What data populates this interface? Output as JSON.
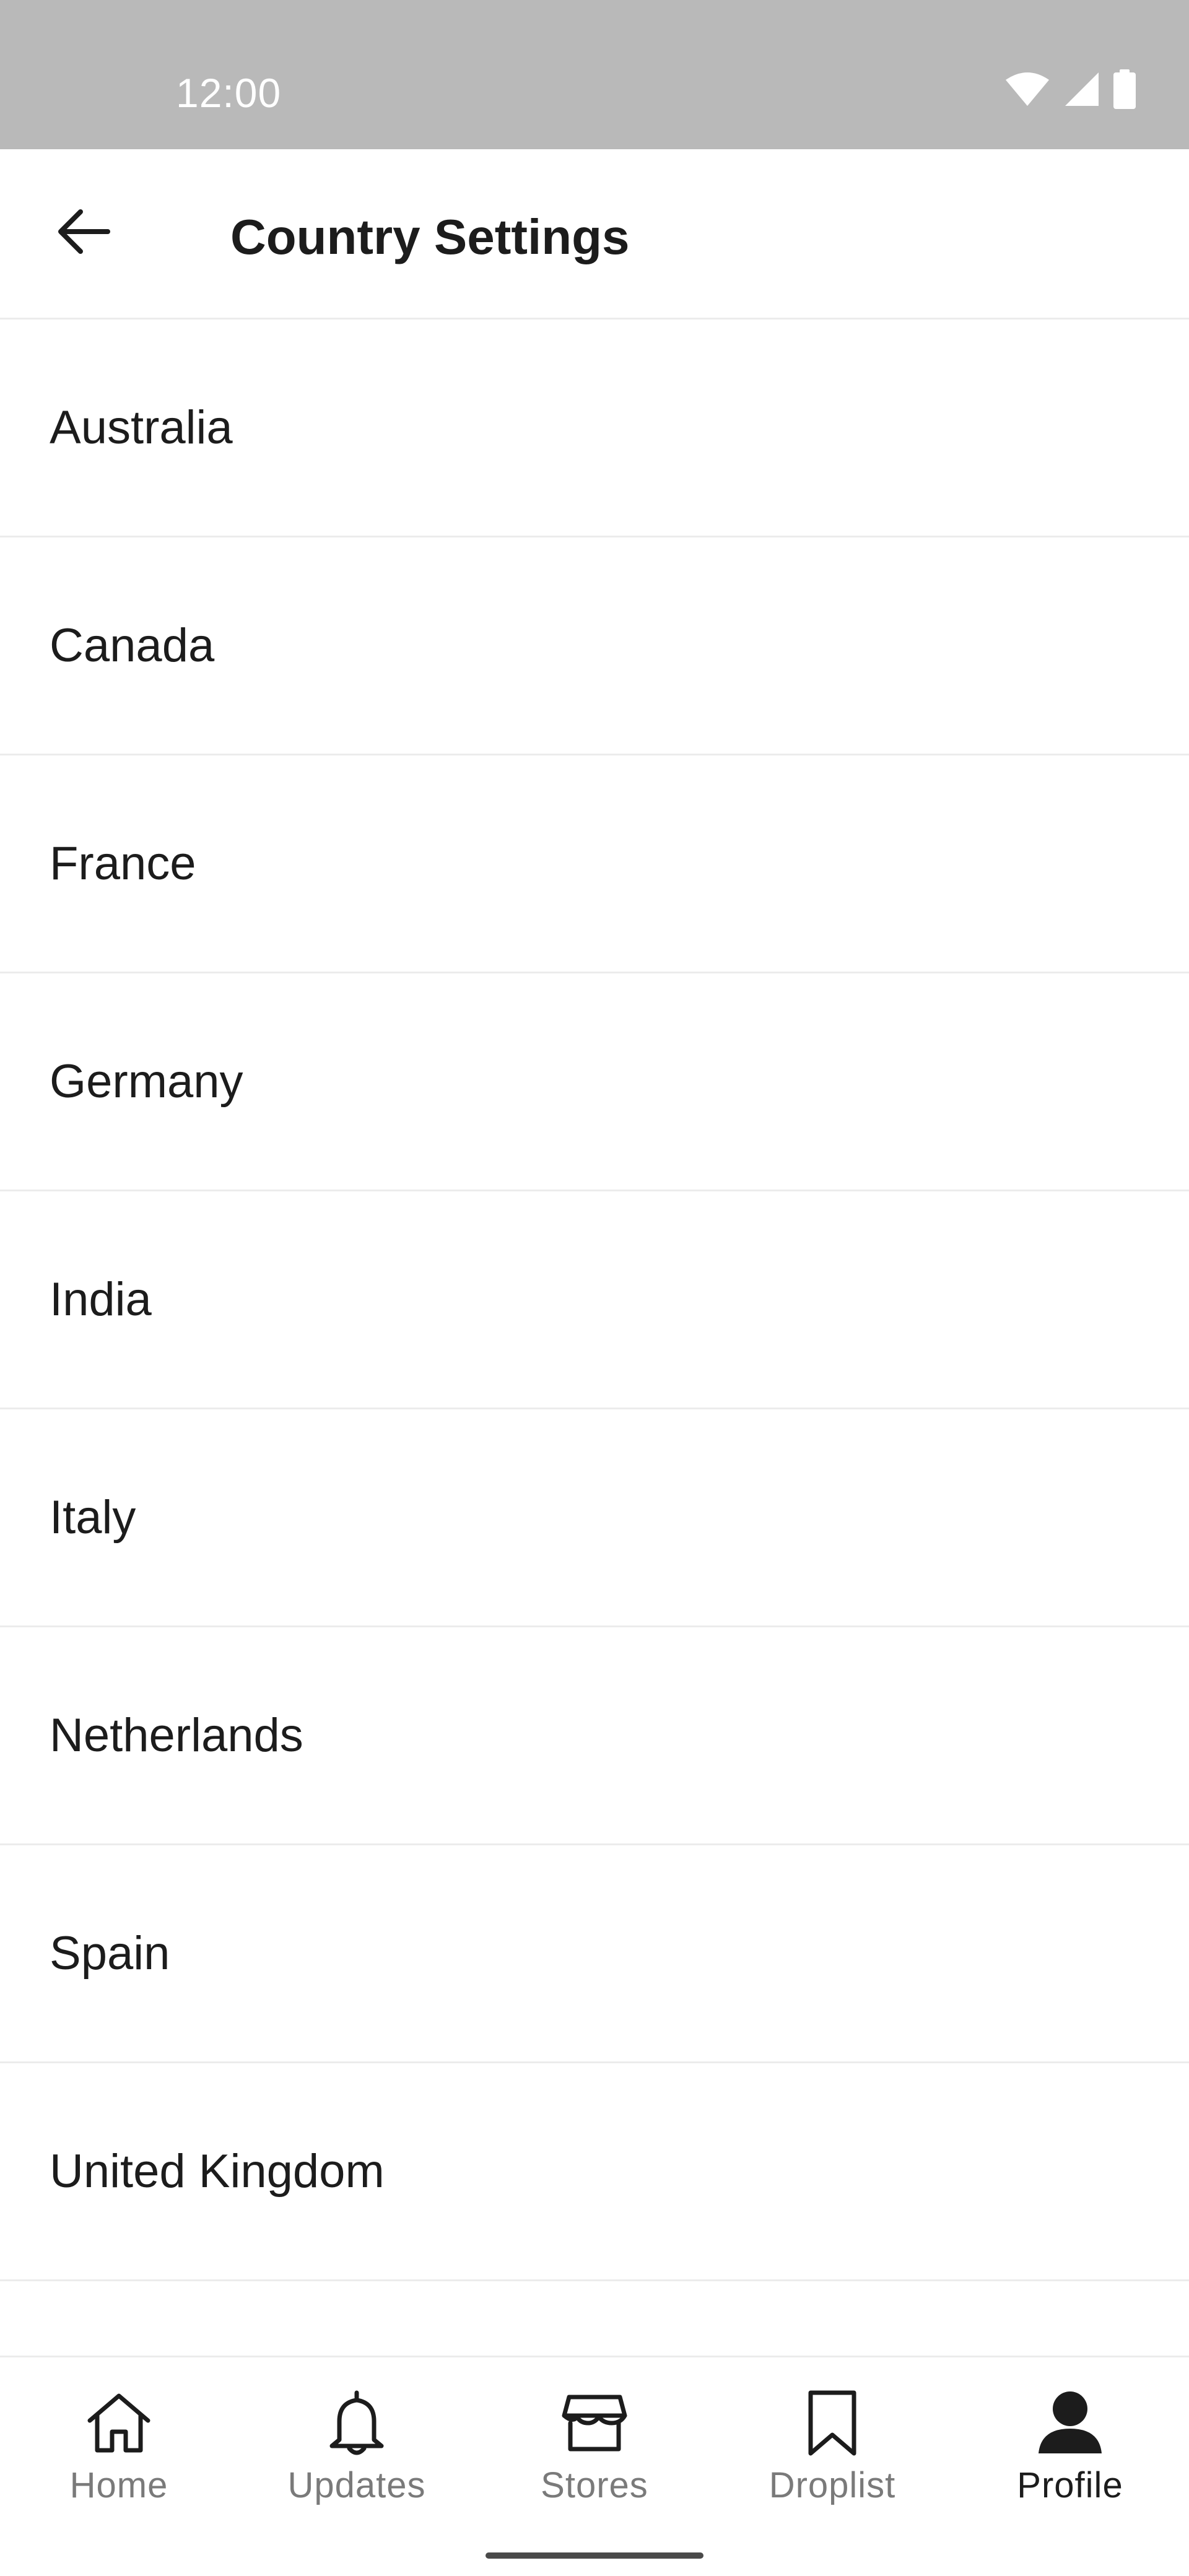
{
  "status_bar": {
    "time": "12:00",
    "icons": [
      "wifi-icon",
      "signal-icon",
      "battery-icon"
    ],
    "background": "#b9b9b9"
  },
  "header": {
    "back_icon": "arrow-left-icon",
    "title": "Country Settings"
  },
  "countries": [
    "Australia",
    "Canada",
    "France",
    "Germany",
    "India",
    "Italy",
    "Netherlands",
    "Spain",
    "United Kingdom"
  ],
  "bottom_nav": {
    "items": [
      {
        "label": "Home",
        "icon": "home-icon",
        "active": false
      },
      {
        "label": "Updates",
        "icon": "bell-icon",
        "active": false
      },
      {
        "label": "Stores",
        "icon": "store-icon",
        "active": false
      },
      {
        "label": "Droplist",
        "icon": "bookmark-icon",
        "active": false
      },
      {
        "label": "Profile",
        "icon": "person-icon",
        "active": true
      }
    ],
    "active_color": "#1c1c1c",
    "inactive_color": "#7a7a7a"
  }
}
